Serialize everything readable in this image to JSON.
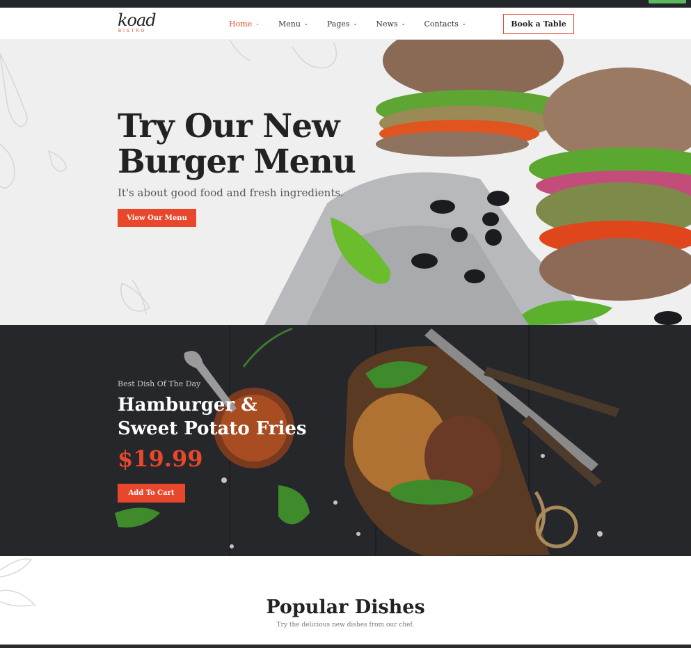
{
  "header": {
    "logo_script": "koad",
    "logo_sub": "BISTRO",
    "nav": [
      {
        "label": "Home",
        "active": true
      },
      {
        "label": "Menu",
        "active": false
      },
      {
        "label": "Pages",
        "active": false
      },
      {
        "label": "News",
        "active": false
      },
      {
        "label": "Contacts",
        "active": false
      }
    ],
    "book_label": "Book a Table"
  },
  "hero": {
    "title": "Try Our New Burger Menu",
    "subtitle": "It's about good food and fresh ingredients.",
    "button_label": "View Our Menu"
  },
  "special": {
    "kicker": "Best Dish Of The Day",
    "title": "Hamburger & Sweet Potato Fries",
    "price": "$19.99",
    "button_label": "Add To Cart"
  },
  "popular": {
    "title": "Popular Dishes",
    "subtitle": "Try the delicious new dishes from our chef."
  },
  "colors": {
    "accent": "#e8472c",
    "dark": "#26272b",
    "hero_bg": "#efefef"
  }
}
